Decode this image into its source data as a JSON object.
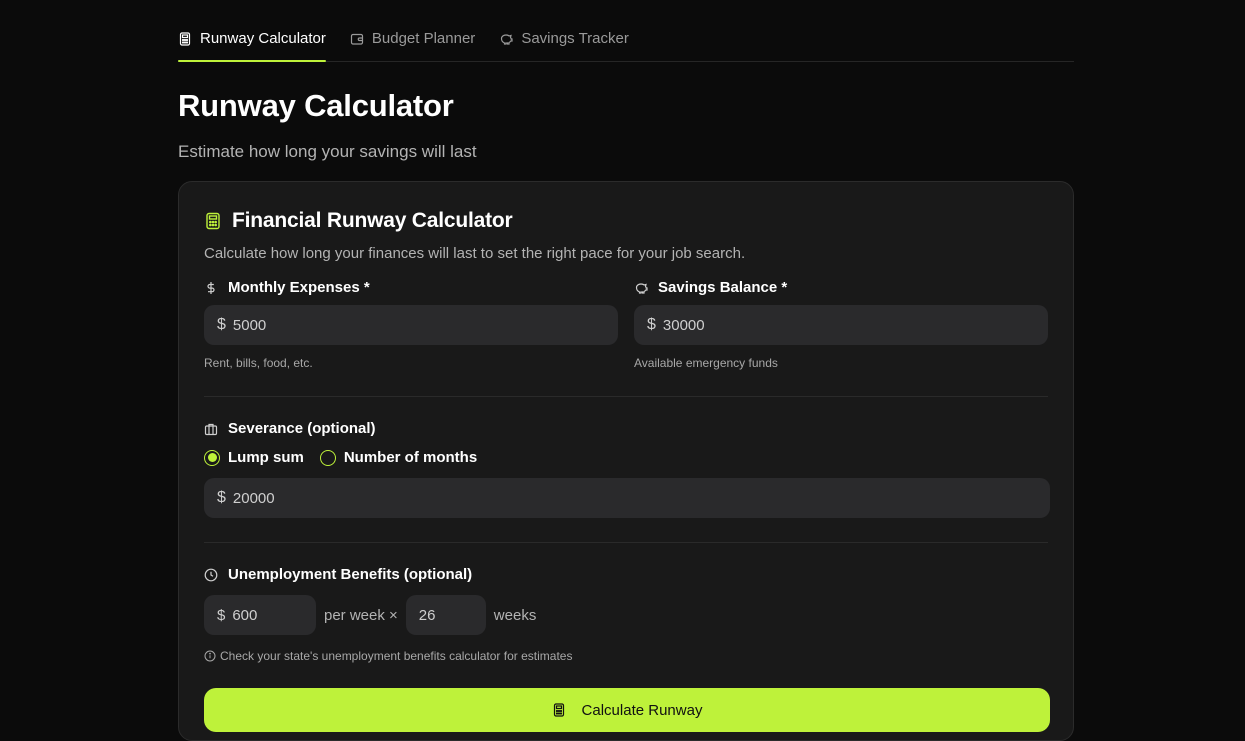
{
  "tabs": [
    {
      "label": "Runway Calculator",
      "icon": "calculator-icon",
      "active": true
    },
    {
      "label": "Budget Planner",
      "icon": "wallet-icon",
      "active": false
    },
    {
      "label": "Savings Tracker",
      "icon": "piggy-bank-icon",
      "active": false
    }
  ],
  "page": {
    "title": "Runway Calculator",
    "subtitle": "Estimate how long your savings will last"
  },
  "card": {
    "title": "Financial Runway Calculator",
    "description": "Calculate how long your finances will last to set the right pace for your job search."
  },
  "monthly_expenses": {
    "label": "Monthly Expenses *",
    "currency": "$",
    "value": "5000",
    "hint": "Rent, bills, food, etc."
  },
  "savings_balance": {
    "label": "Savings Balance *",
    "currency": "$",
    "value": "30000",
    "hint": "Available emergency funds"
  },
  "severance": {
    "label": "Severance (optional)",
    "options": [
      "Lump sum",
      "Number of months"
    ],
    "selected": "Lump sum",
    "currency": "$",
    "value": "20000"
  },
  "unemployment": {
    "label": "Unemployment Benefits (optional)",
    "currency": "$",
    "weekly_amount": "600",
    "per_week_text": "per week ×",
    "weeks": "26",
    "weeks_text": "weeks",
    "info": "Check your state's unemployment benefits calculator for estimates"
  },
  "calculate_button": {
    "label": "Calculate Runway"
  },
  "colors": {
    "accent": "#bef23a",
    "background": "#0b0b0b",
    "card": "#191919",
    "input": "#2a2a2c"
  }
}
